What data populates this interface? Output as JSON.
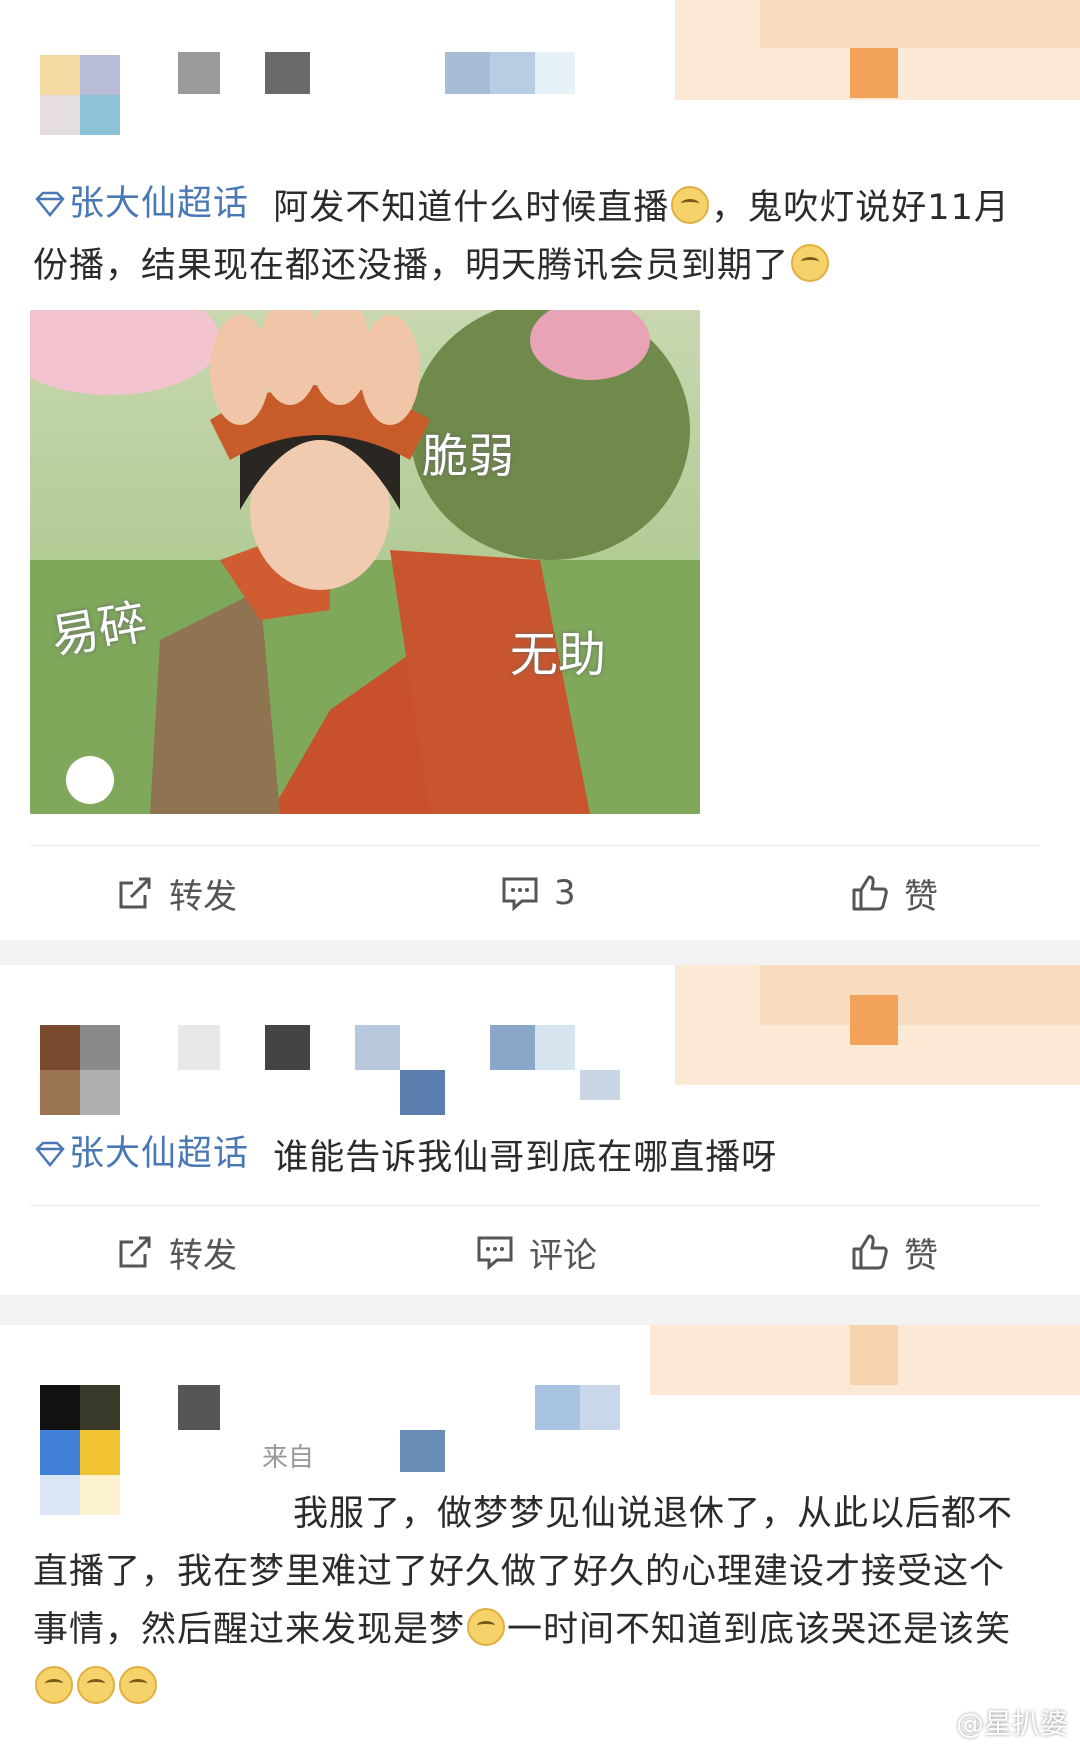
{
  "posts": [
    {
      "topic": "张大仙超话",
      "text": "阿发不知道什么时候直播",
      "text2": "，鬼吹灯说好11月份播，结果现在都还没播，明天腾讯会员到期了",
      "image": {
        "labels": [
          "脆弱",
          "易碎",
          "无助"
        ]
      },
      "actions": {
        "repost": "转发",
        "comment": "3",
        "like": "赞"
      }
    },
    {
      "topic": "张大仙超话",
      "text": "谁能告诉我仙哥到底在哪直播呀",
      "actions": {
        "repost": "转发",
        "comment": "评论",
        "like": "赞"
      }
    },
    {
      "source_fragment": "来自",
      "text": "我服了，做梦梦见仙说退休了，从此以后都不直播了，我在梦里难过了好久做了好久的心理建设才接受这个事情，然后醒过来发现是梦",
      "text2": "一时间不知道到底该哭还是该笑"
    }
  ],
  "watermark": "@星扒婆",
  "colors": {
    "topic": "#4a78b4",
    "accent_block": "#f2a25a"
  },
  "icons": [
    "diamond-topic-icon",
    "repost-icon",
    "comment-icon",
    "like-icon",
    "emoji-icon"
  ]
}
